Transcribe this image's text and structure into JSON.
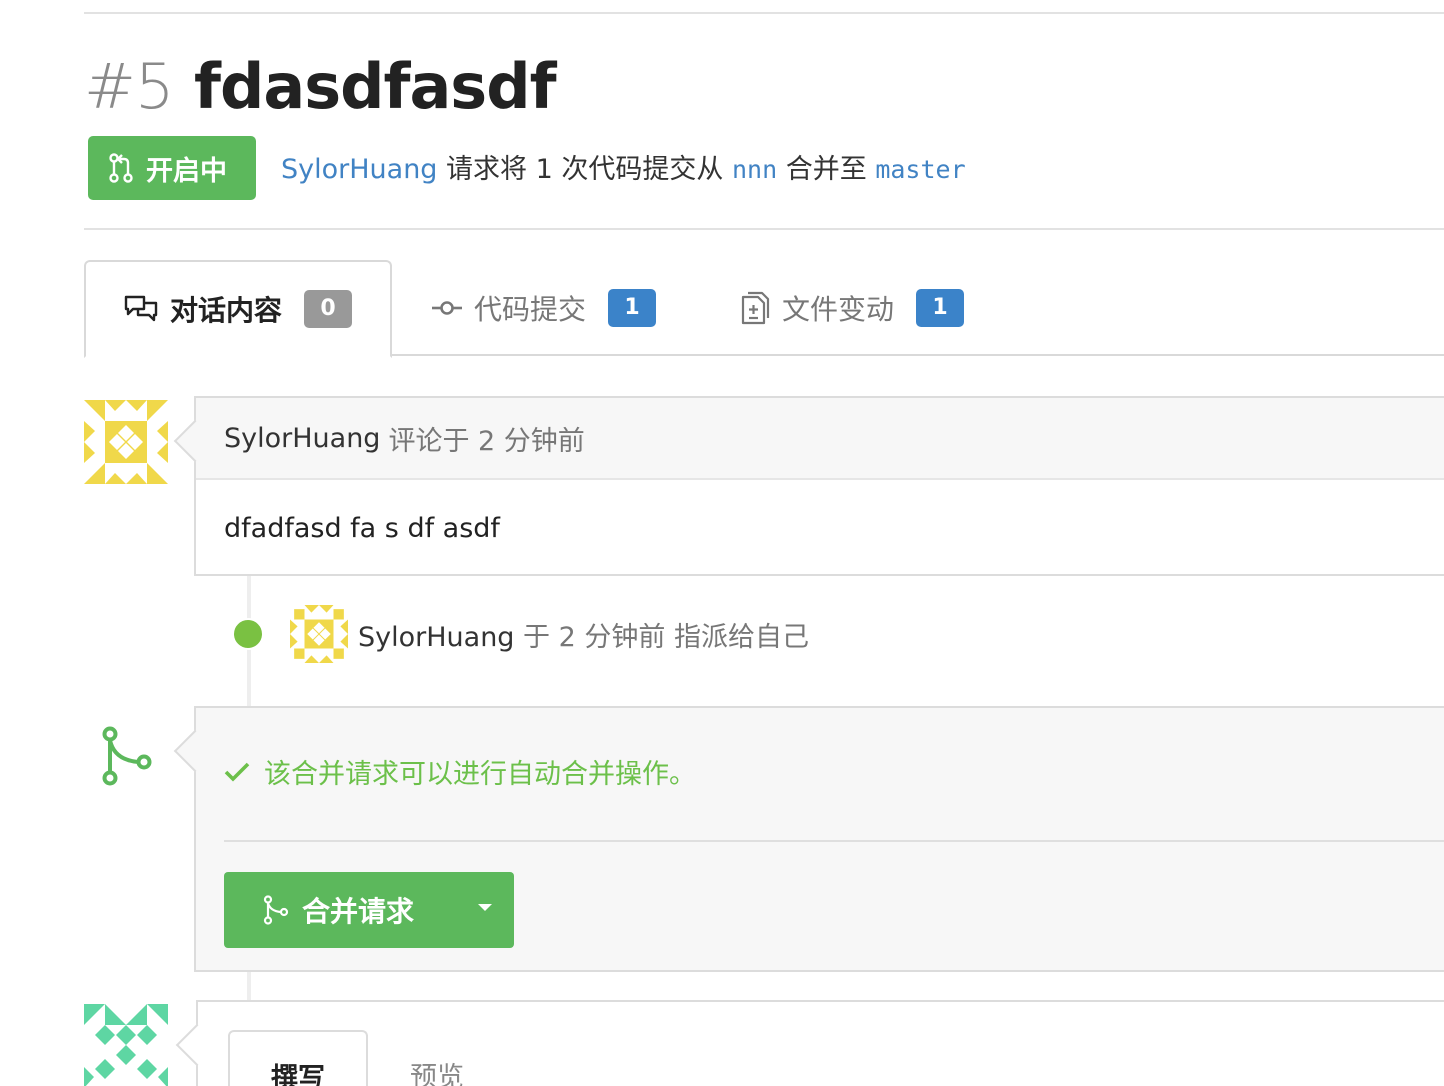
{
  "pull_request": {
    "number": "#5",
    "title": "fdasdfasdf",
    "state_label": "开启中",
    "author": "SylorHuang",
    "summary_middle": "请求将 1 次代码提交从",
    "head_branch": "nnn",
    "summary_merge": "合并至",
    "base_branch": "master"
  },
  "tabs": [
    {
      "label": "对话内容",
      "count": "0",
      "icon": "comment-discussion-icon"
    },
    {
      "label": "代码提交",
      "count": "1",
      "icon": "git-commit-icon"
    },
    {
      "label": "文件变动",
      "count": "1",
      "icon": "file-diff-icon"
    }
  ],
  "comment": {
    "author": "SylorHuang",
    "meta": "评论于 2 分钟前",
    "body": "dfadfasd fa s df asdf"
  },
  "event": {
    "author": "SylorHuang",
    "text": "于 2 分钟前 指派给自己"
  },
  "merge": {
    "status": "该合并请求可以进行自动合并操作。",
    "button_label": "合并请求"
  },
  "reply": {
    "write_tab": "撰写",
    "preview_tab": "预览"
  },
  "colors": {
    "green": "#5cb85c",
    "blue_badge": "#3b83c9",
    "link": "#4183c4",
    "avatar_yellow": "#f0d84a",
    "avatar_teal": "#5ed6a3"
  }
}
